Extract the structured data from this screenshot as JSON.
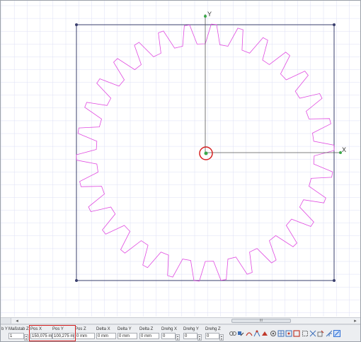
{
  "canvas": {
    "background": "#ffffff",
    "grid_color": "#dcdff5",
    "gear_color": "#e04be0",
    "frame_color": "#3a3f6e",
    "axis_color": "#555555",
    "handle_color": "#3aa84a",
    "gear_teeth": 30,
    "axis_y_label": "Y",
    "axis_x_label": "X",
    "origin_marker_color": "#d62020"
  },
  "scrollbar": {
    "left_end_glyph": "",
    "left_arrow": "◂",
    "thumb_grip": "III",
    "right_arrow": "▸"
  },
  "fields": [
    {
      "label": "b Y",
      "value": "",
      "spinner": false
    },
    {
      "label": "Maßstab Z",
      "value": "1",
      "spinner": true
    },
    {
      "label": "Pos X",
      "value": "150,075 m",
      "spinner": false
    },
    {
      "label": "Pos Y",
      "value": "100,275 m",
      "spinner": false
    },
    {
      "label": "Pos Z",
      "value": "0 mm",
      "spinner": false
    },
    {
      "label": "Delta X",
      "value": "0 mm",
      "spinner": false
    },
    {
      "label": "Delta Y",
      "value": "0 mm",
      "spinner": false
    },
    {
      "label": "Delta Z",
      "value": "0 mm",
      "spinner": false
    },
    {
      "label": "Drehg X",
      "value": "0",
      "spinner": true
    },
    {
      "label": "Drehg Y",
      "value": "0",
      "spinner": true
    },
    {
      "label": "Drehg Z",
      "value": "0",
      "spinner": true
    }
  ],
  "tools": [
    {
      "icon": "chain-link-icon",
      "color": "#6a6a6a"
    },
    {
      "icon": "snap-object-icon",
      "color": "#3d6fb8"
    },
    {
      "icon": "snap-curve-icon",
      "color": "#c0392b"
    },
    {
      "icon": "snap-endpoint-icon",
      "color": "#3d6fb8"
    },
    {
      "icon": "snap-color-icon",
      "color": "#c0392b"
    },
    {
      "icon": "snap-target-icon",
      "color": "#555555"
    },
    {
      "icon": "snap-grid-icon",
      "color": "#3d6fb8"
    },
    {
      "icon": "snap-midpoint-icon",
      "color": "#3d6fb8"
    },
    {
      "icon": "snap-box-icon",
      "color": "#c0392b"
    },
    {
      "icon": "snap-frame-icon",
      "color": "#555555"
    },
    {
      "icon": "snap-intersect-icon",
      "color": "#3d6fb8"
    },
    {
      "icon": "snap-tangent-icon",
      "color": "#c0392b"
    },
    {
      "icon": "snap-perpendicular-icon",
      "color": "#3d6fb8"
    },
    {
      "icon": "snap-active-icon",
      "color": "#2f6fd6"
    }
  ]
}
